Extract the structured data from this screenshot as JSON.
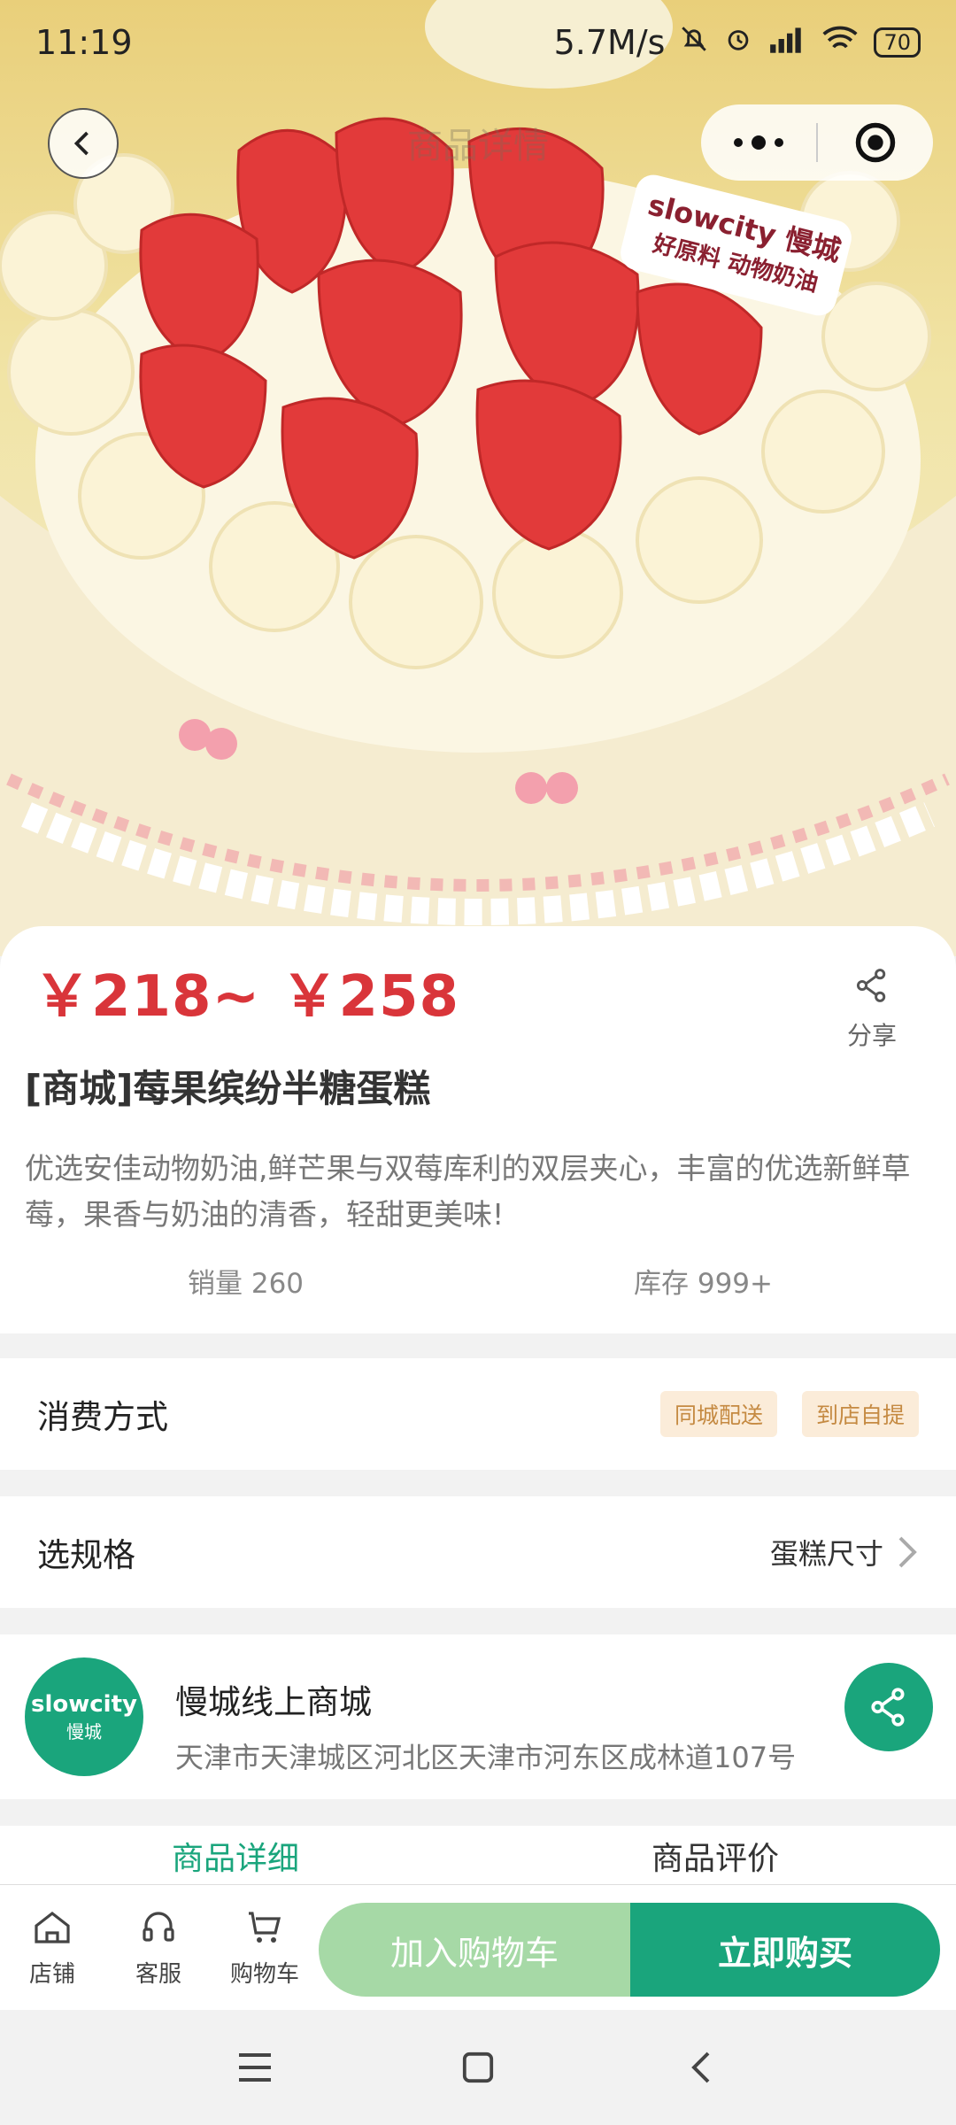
{
  "status_bar": {
    "time": "11:19",
    "network_speed": "5.7M/s",
    "battery": "70",
    "icons": [
      "mute-bell-icon",
      "alarm-icon",
      "signal-icon",
      "wifi-icon",
      "battery-icon"
    ]
  },
  "header": {
    "title": "商品详情"
  },
  "hero": {
    "brand_tag_line1": "slowcity 慢城",
    "brand_tag_line2": "好原料 动物奶油"
  },
  "product": {
    "price": "￥218~ ￥258",
    "share_label": "分享",
    "title": "[商城]莓果缤纷半糖蛋糕",
    "description": "优选安佳动物奶油,鲜芒果与双莓库利的双层夹心，丰富的优选新鲜草莓，果香与奶油的清香，轻甜更美味!",
    "sales": "销量 260",
    "stock": "库存 999+"
  },
  "consumption": {
    "label": "消费方式",
    "options": [
      "同城配送",
      "到店自提"
    ]
  },
  "spec": {
    "label": "选规格",
    "value": "蛋糕尺寸"
  },
  "store": {
    "logo_text": "slowcity",
    "logo_sub": "慢城",
    "name": "慢城线上商城",
    "address": "天津市天津城区河北区天津市河东区成林道107号"
  },
  "tabs": [
    {
      "label": "商品详细"
    },
    {
      "label": "商品评价"
    }
  ],
  "bottom_bar": {
    "shop_label": "店铺",
    "service_label": "客服",
    "cart_label": "购物车",
    "add_to_cart": "加入购物车",
    "buy_now": "立即购买"
  },
  "colors": {
    "accent_green": "#1aa57c",
    "light_green": "#a6d9a6",
    "price_red": "#d9353a",
    "tag_bg": "#fbecd9",
    "tag_text": "#c58a42"
  }
}
